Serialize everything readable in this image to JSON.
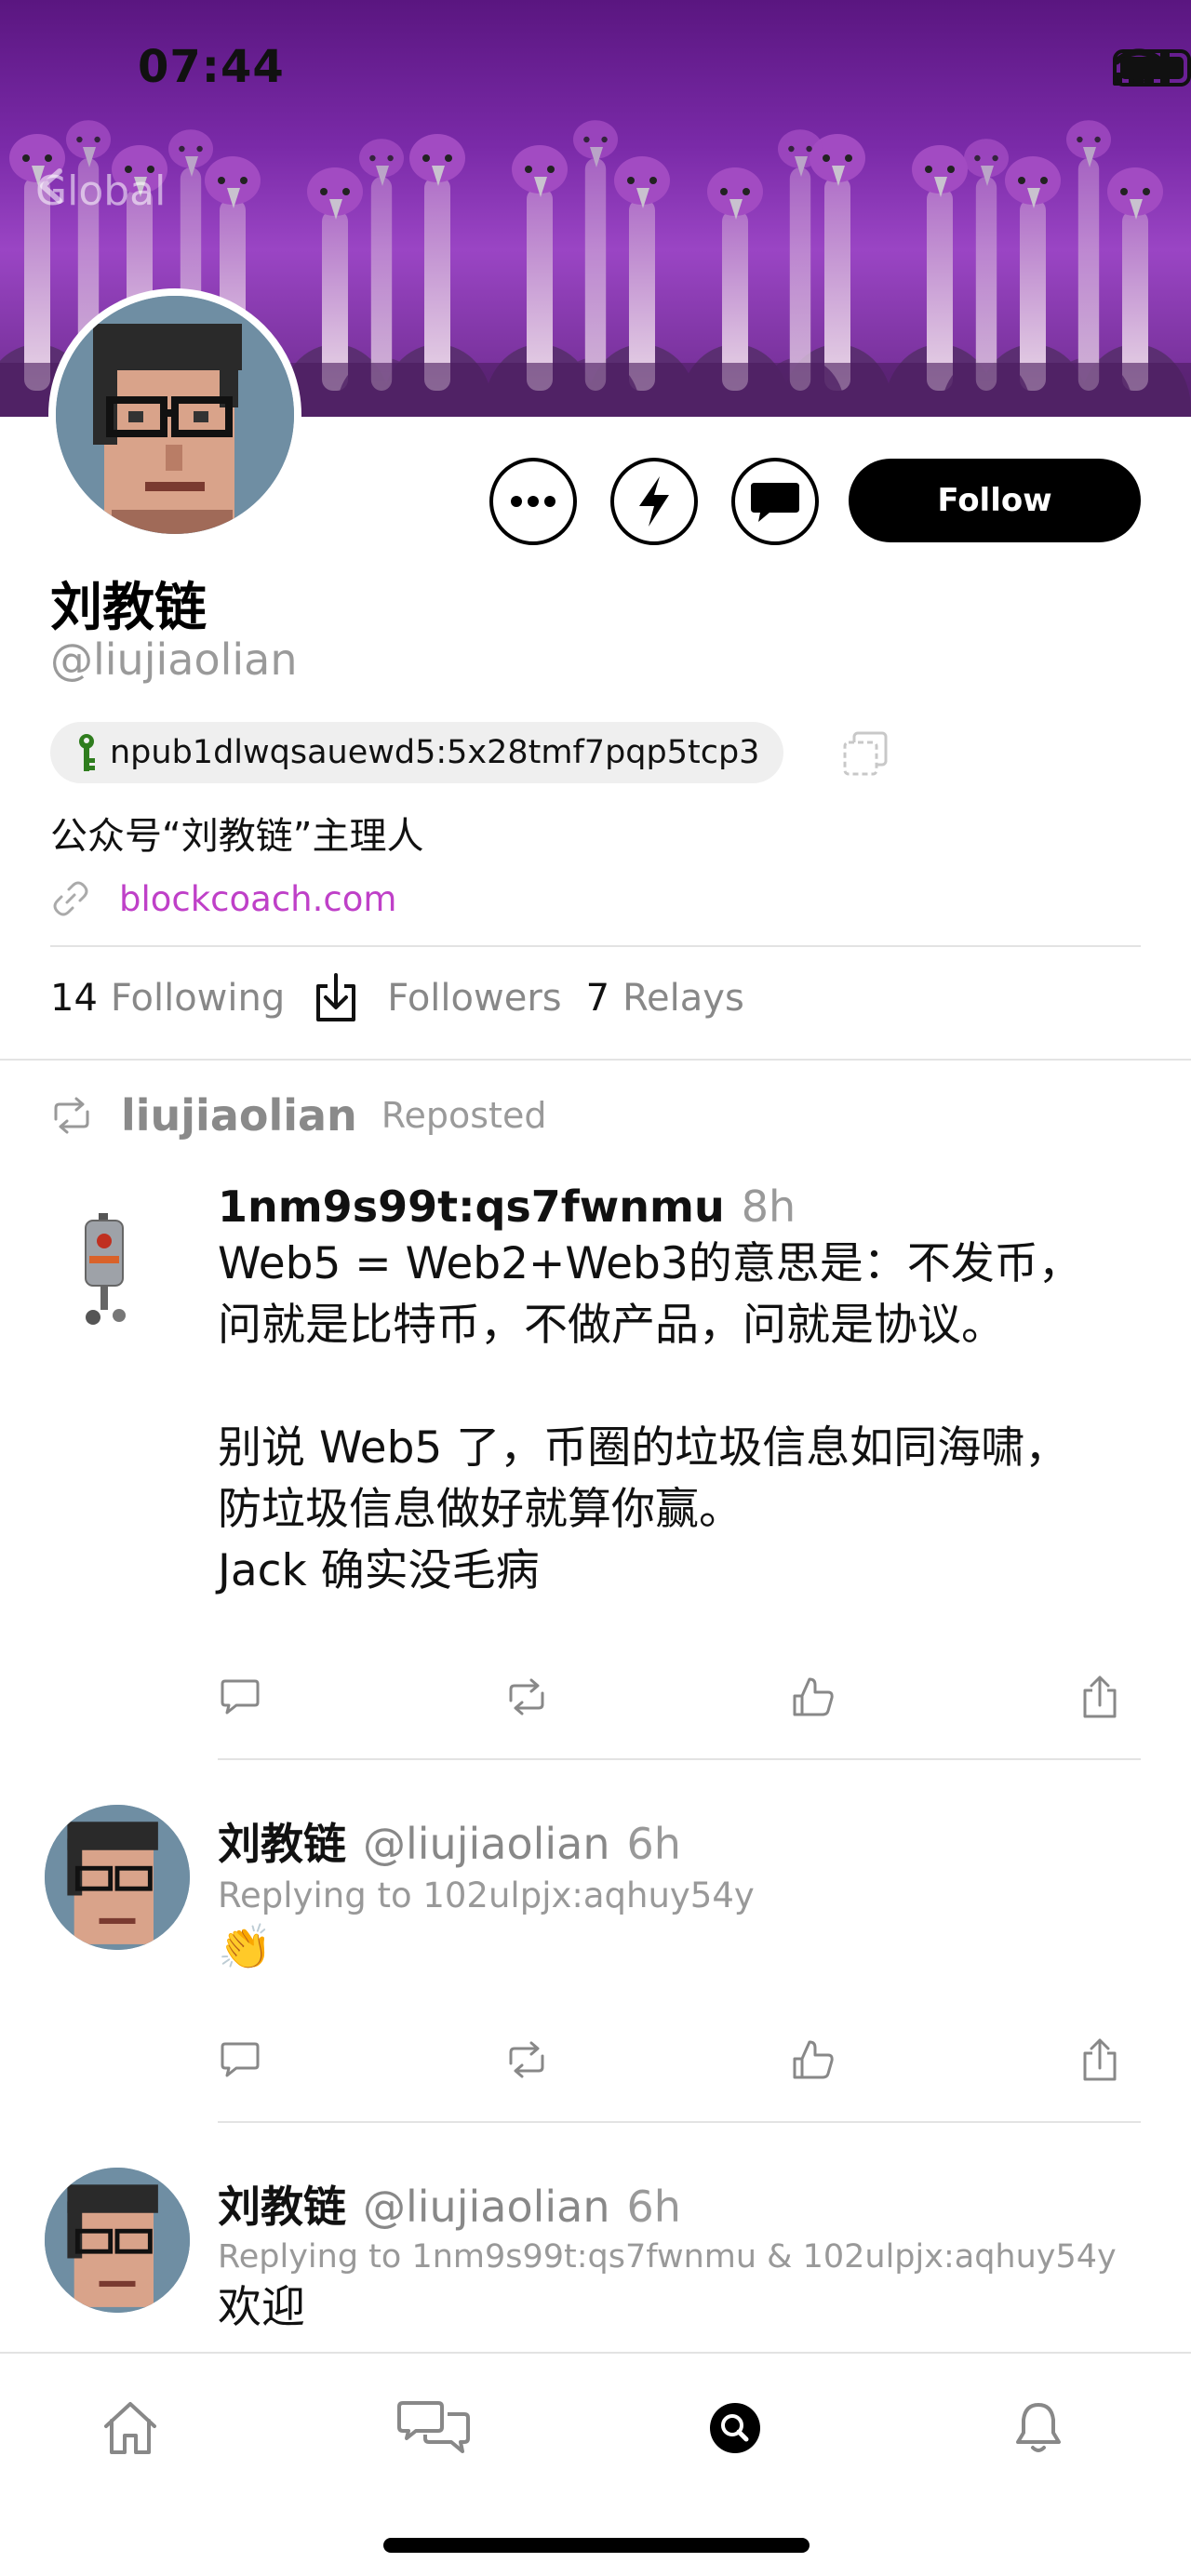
{
  "status_bar": {
    "time": "07:44"
  },
  "header": {
    "back_label": "Global"
  },
  "profile": {
    "display_name": "刘教链",
    "handle": "@liujiaolian",
    "npub": "npub1dlwqsauewd5:5x28tmf7pqp5tcp3",
    "bio": "公众号“刘教链”主理人",
    "website": "blockcoach.com",
    "follow_label": "Follow"
  },
  "stats": {
    "following_count": "14",
    "following_label": "Following",
    "followers_label": "Followers",
    "relays_count": "7",
    "relays_label": "Relays"
  },
  "feed": {
    "repost": {
      "user": "liujiaolian",
      "label": "Reposted"
    },
    "posts": [
      {
        "author": "1nm9s99t:qs7fwnmu",
        "handle": "",
        "time": "8h",
        "reply_to": "",
        "text": "Web5 = Web2+Web3的意思是：不发币，\n问就是比特币，不做产品，问就是协议。\n\n别说 Web5 了，币圈的垃圾信息如同海啸，\n防垃圾信息做好就算你赢。\nJack 确实没毛病"
      },
      {
        "author": "刘教链",
        "handle": "@liujiaolian",
        "time": "6h",
        "reply_to": "Replying to 102ulpjx:aqhuy54y",
        "text": "👏"
      },
      {
        "author": "刘教链",
        "handle": "@liujiaolian",
        "time": "6h",
        "reply_to": "Replying to 1nm9s99t:qs7fwnmu & 102ulpjx:aqhuy54y",
        "text": "欢迎"
      }
    ]
  },
  "icons": {
    "more": "more-icon",
    "zap": "lightning-icon",
    "message": "message-icon",
    "key": "key-icon",
    "copy": "copy-icon",
    "link": "link-icon",
    "followers": "download-icon",
    "repost": "repost-icon",
    "reply": "reply-icon",
    "like": "like-icon",
    "share": "share-icon",
    "home": "home-icon",
    "dms": "chat-icon",
    "search": "search-icon",
    "notifications": "bell-icon"
  },
  "colors": {
    "link": "#bf40c8",
    "banner": "#7a2aa8",
    "key": "#2f7d1e"
  }
}
